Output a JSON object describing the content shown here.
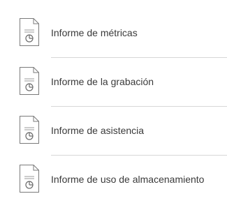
{
  "reports": [
    {
      "label": "Informe de métricas",
      "icon": "report-chart-icon"
    },
    {
      "label": "Informe de la grabación",
      "icon": "report-chart-icon"
    },
    {
      "label": "Informe de asistencia",
      "icon": "report-chart-icon"
    },
    {
      "label": "Informe de uso de almacenamiento",
      "icon": "report-chart-icon"
    }
  ]
}
